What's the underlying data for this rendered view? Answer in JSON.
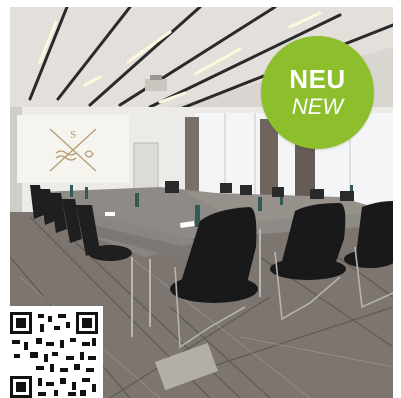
{
  "badge": {
    "main": "NEU",
    "sub": "NEW",
    "color": "#8dbf2c",
    "text_color": "#ffffff"
  },
  "projection_screen": {
    "logo_letter": "S",
    "logo_icon": "crossed-cutlery-wheat-icon"
  },
  "qr_code": {
    "icon": "qr-code-icon"
  }
}
